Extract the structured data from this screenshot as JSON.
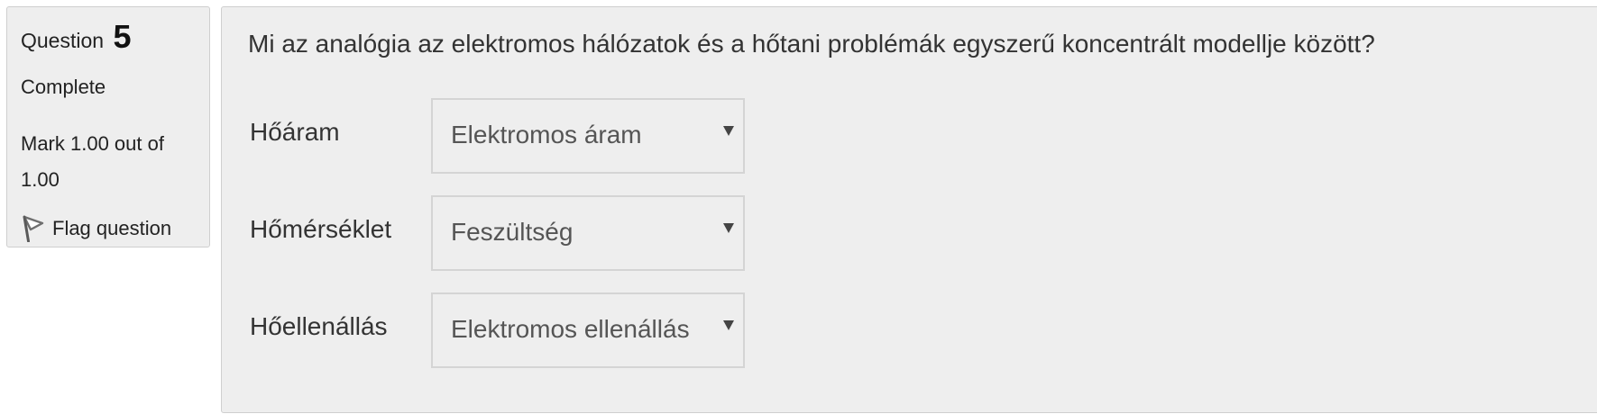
{
  "question_info": {
    "heading_prefix": "Question",
    "number": "5",
    "state": "Complete",
    "grade_line1": "Mark 1.00 out of",
    "grade_line2": "1.00",
    "flag_label": "Flag question",
    "flag_icon": "flag-icon"
  },
  "question": {
    "text": "Mi az analógia az elektromos hálózatok és a hőtani problémák egyszerű koncentrált modellje között?",
    "matches": [
      {
        "label": "Hőáram",
        "selected": "Elektromos áram"
      },
      {
        "label": "Hőmérséklet",
        "selected": "Feszültség"
      },
      {
        "label": "Hőellenállás",
        "selected": "Elektromos ellenállás"
      }
    ]
  },
  "colors": {
    "panel_background": "#eeeeee",
    "panel_border": "#cfcfcf",
    "text": "#333333"
  }
}
